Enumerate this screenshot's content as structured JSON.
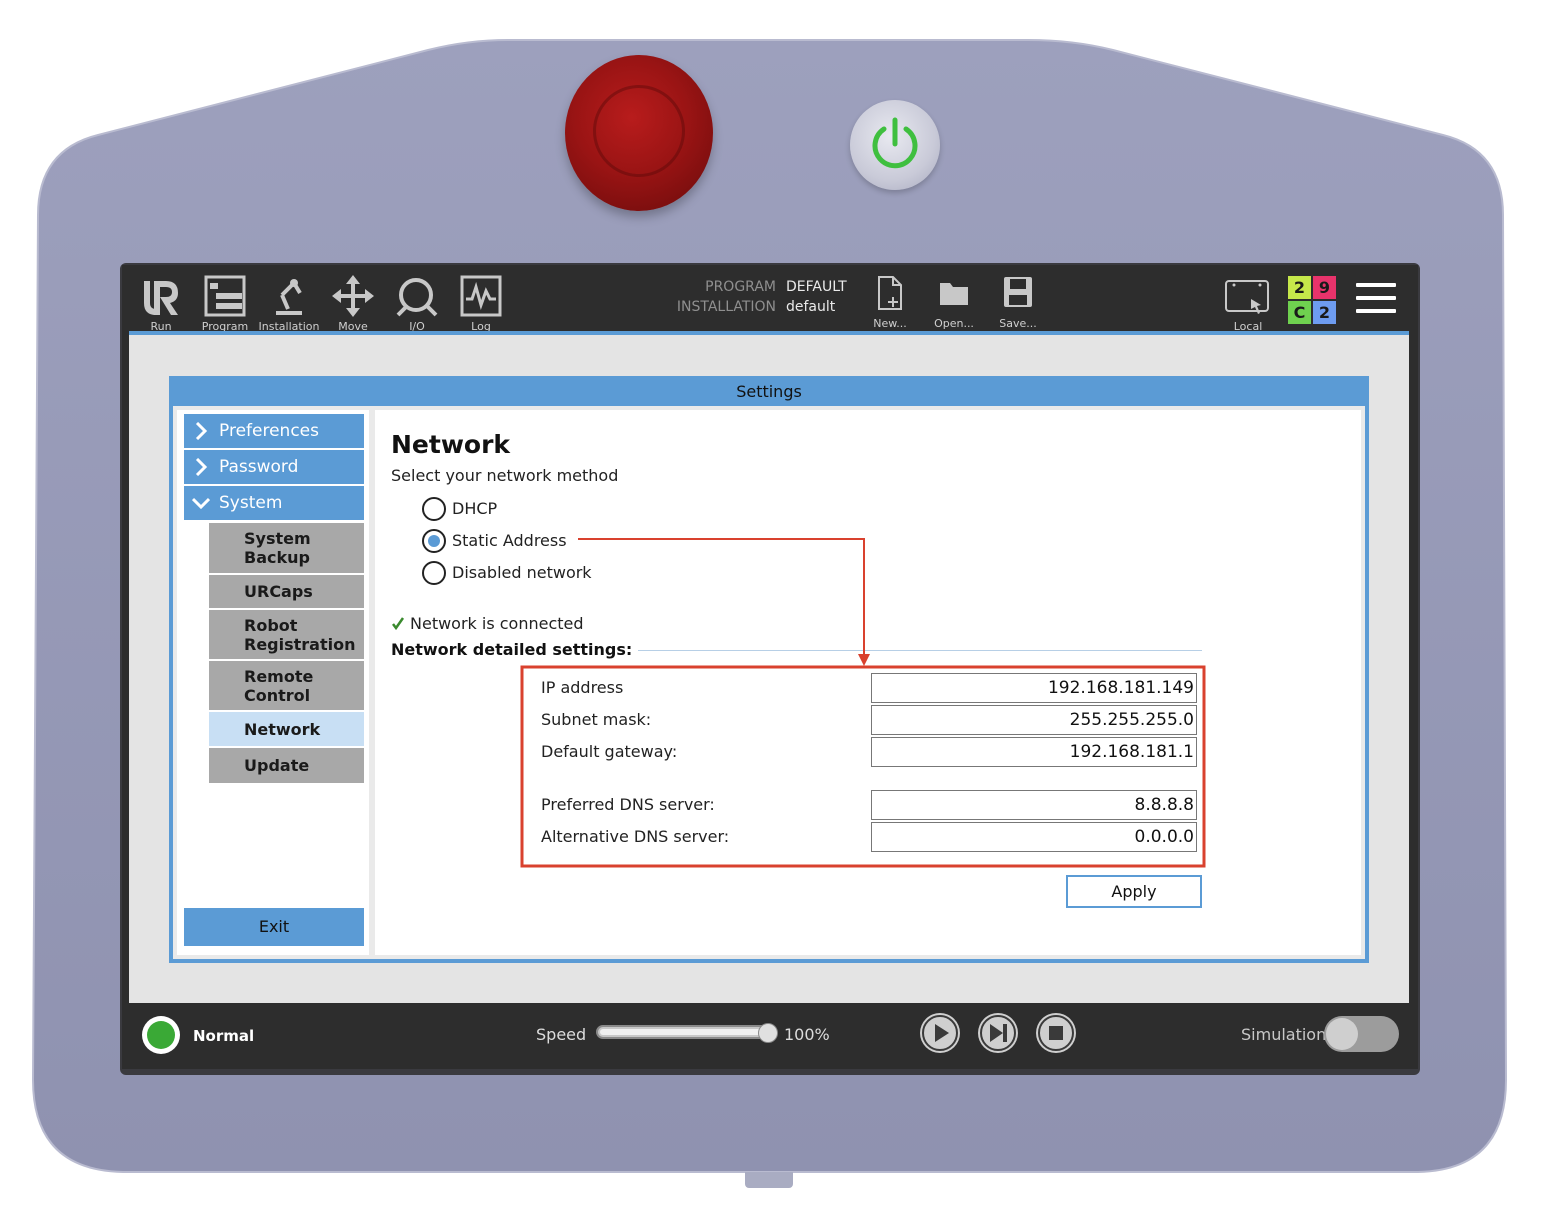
{
  "topbar": {
    "nav": [
      {
        "label": "Run",
        "icon": "ur-logo-icon"
      },
      {
        "label": "Program",
        "icon": "program-icon"
      },
      {
        "label": "Installation",
        "icon": "robot-arm-icon"
      },
      {
        "label": "Move",
        "icon": "move-arrows-icon"
      },
      {
        "label": "I/O",
        "icon": "io-icon"
      },
      {
        "label": "Log",
        "icon": "log-graph-icon"
      }
    ],
    "program_key": "PROGRAM",
    "program_value": "DEFAULT",
    "installation_key": "INSTALLATION",
    "installation_value": "default",
    "file_buttons": [
      {
        "label": "New...",
        "icon": "new-file-icon"
      },
      {
        "label": "Open...",
        "icon": "open-folder-icon"
      },
      {
        "label": "Save...",
        "icon": "save-disk-icon"
      }
    ],
    "local_label": "Local",
    "badges": [
      {
        "text": "2",
        "color": "#c6e84a"
      },
      {
        "text": "9",
        "color": "#e8336b"
      },
      {
        "text": "C",
        "color": "#6fd14f"
      },
      {
        "text": "2",
        "color": "#6e9cf0"
      }
    ]
  },
  "dialog": {
    "title": "Settings",
    "menu": [
      {
        "label": "Preferences",
        "expanded": false
      },
      {
        "label": "Password",
        "expanded": false
      },
      {
        "label": "System",
        "expanded": true
      }
    ],
    "submenu": [
      {
        "label": "System Backup"
      },
      {
        "label": "URCaps"
      },
      {
        "label": "Robot Registration"
      },
      {
        "label": "Remote Control"
      },
      {
        "label": "Network",
        "active": true
      },
      {
        "label": "Update"
      }
    ],
    "exit_label": "Exit"
  },
  "network": {
    "title": "Network",
    "subtitle": "Select your network method",
    "methods": [
      {
        "label": "DHCP",
        "checked": false
      },
      {
        "label": "Static Address",
        "checked": true
      },
      {
        "label": "Disabled network",
        "checked": false
      }
    ],
    "status": "Network is connected",
    "details_title": "Network detailed settings:",
    "fields": [
      {
        "label": "IP address",
        "value": "192.168.181.149"
      },
      {
        "label": "Subnet mask:",
        "value": "255.255.255.0"
      },
      {
        "label": "Default gateway:",
        "value": "192.168.181.1"
      },
      {
        "label": "Preferred DNS server:",
        "value": "8.8.8.8"
      },
      {
        "label": "Alternative DNS server:",
        "value": "0.0.0.0"
      }
    ],
    "apply_label": "Apply"
  },
  "footer": {
    "status": "Normal",
    "speed_label": "Speed",
    "speed_value": "100%",
    "speed_fraction": 1.0,
    "simulation_label": "Simulation",
    "simulation_on": false
  },
  "colors": {
    "accent": "#5b9bd5",
    "annotation": "#d9412e",
    "status_ok": "#3aa936"
  }
}
